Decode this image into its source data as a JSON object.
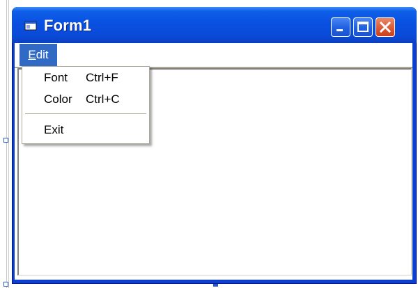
{
  "window": {
    "title": "Form1",
    "icon": "form-icon"
  },
  "titlebar_buttons": [
    "minimize",
    "maximize",
    "close"
  ],
  "menubar": {
    "items": [
      {
        "label_prefix": "E",
        "label_rest": "dit"
      }
    ]
  },
  "edit_menu": {
    "items": [
      {
        "label": "Font",
        "shortcut": "Ctrl+F"
      },
      {
        "label": "Color",
        "shortcut": "Ctrl+C"
      },
      {
        "label": "Exit",
        "shortcut": ""
      }
    ]
  },
  "colors": {
    "titlebar": "#0a4ad8",
    "menu_highlight": "#316ac5",
    "close_button": "#dc5a33"
  }
}
